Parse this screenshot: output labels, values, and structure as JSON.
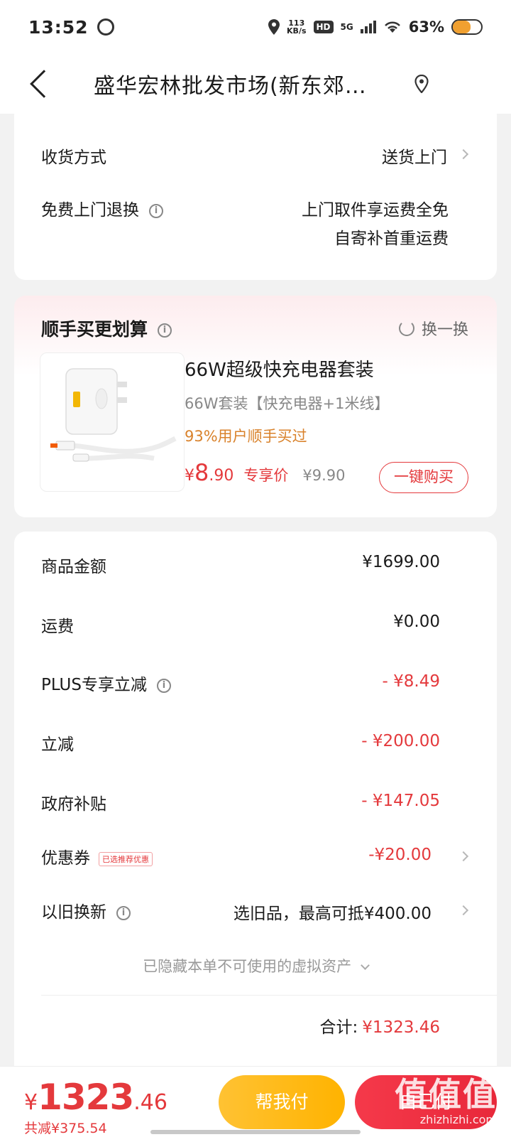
{
  "status": {
    "time": "13:52",
    "net_speed_top": "113",
    "net_speed_bottom": "KB/s",
    "hd": "HD",
    "network": "5G",
    "battery": "63%"
  },
  "nav": {
    "title": "盛华宏林批发市场(新东郊…"
  },
  "delivery": {
    "method_label": "收货方式",
    "method_value": "送货上门",
    "return_label": "免费上门退换",
    "return_line1": "上门取件享运费全免",
    "return_line2": "自寄补首重运费"
  },
  "addon": {
    "title": "顺手买更划算",
    "swap_label": "换一换",
    "product_name": "66W超级快充电器套装",
    "product_spec": "66W套装【快充电器+1米线】",
    "social_proof": "93%用户顺手买过",
    "price_yen": "¥",
    "price_int": "8",
    "price_dec": ".90",
    "exclusive_label": "专享价",
    "original_price": "¥9.90",
    "buy_button": "一键购买"
  },
  "summary": {
    "rows": [
      {
        "label": "商品金额",
        "value": "¥1699.00"
      },
      {
        "label": "运费",
        "value": "¥0.00"
      },
      {
        "label": "PLUS专享立减",
        "value": "- ¥8.49"
      },
      {
        "label": "立减",
        "value": "- ¥200.00"
      },
      {
        "label": "政府补贴",
        "value": "- ¥147.05"
      },
      {
        "label": "优惠券",
        "value": "-¥20.00",
        "tag": "已选推荐优惠"
      },
      {
        "label": "以旧换新",
        "value": "选旧品，最高可抵¥400.00"
      }
    ],
    "hidden_note": "已隐藏本单不可使用的虚拟资产",
    "total_label": "合计:",
    "total_value": "¥1323.46"
  },
  "bottom": {
    "yen": "¥",
    "price_int": "1323",
    "price_dec": ".46",
    "saved": "共减¥375.54",
    "help_pay": "帮我付",
    "pay_self": "自己付"
  },
  "watermark": {
    "glyphs": "值值值",
    "url": "zhizhizhi.com"
  },
  "colors": {
    "accent_red": "#e4393c",
    "help_pay_yellow": "#ffb300",
    "social_orange": "#d9822b"
  }
}
